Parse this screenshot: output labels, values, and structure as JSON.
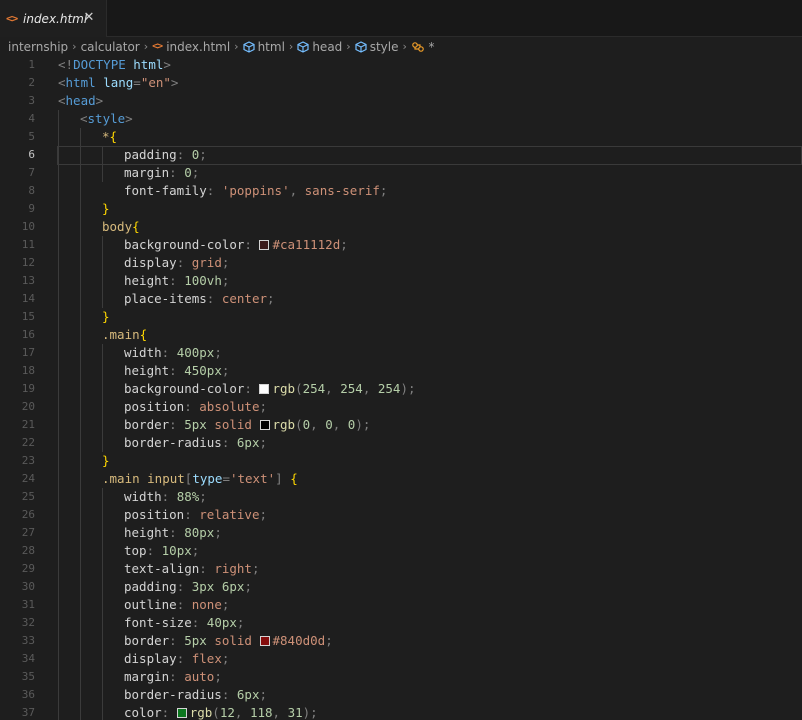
{
  "tab": {
    "label": "index.html",
    "file_icon": "<>",
    "close_glyph": "✕"
  },
  "breadcrumb": {
    "parts": [
      "internship",
      "calculator",
      "index.html",
      "html",
      "head",
      "style"
    ],
    "last": "*",
    "separator": "›"
  },
  "editor": {
    "current_line": 6,
    "lines": [
      {
        "n": "1",
        "tokens": [
          [
            "punc",
            "<!"
          ],
          [
            "tag",
            "DOCTYPE"
          ],
          [
            "text",
            " "
          ],
          [
            "attr",
            "html"
          ],
          [
            "punc",
            ">"
          ]
        ],
        "indent": 0
      },
      {
        "n": "2",
        "tokens": [
          [
            "punc",
            "<"
          ],
          [
            "tag",
            "html"
          ],
          [
            "text",
            " "
          ],
          [
            "attr",
            "lang"
          ],
          [
            "punc",
            "="
          ],
          [
            "str",
            "\"en\""
          ],
          [
            "punc",
            ">"
          ]
        ],
        "indent": 0
      },
      {
        "n": "3",
        "tokens": [
          [
            "punc",
            "<"
          ],
          [
            "tag",
            "head"
          ],
          [
            "punc",
            ">"
          ]
        ],
        "indent": 0
      },
      {
        "n": "4",
        "tokens": [
          [
            "punc",
            "<"
          ],
          [
            "tag",
            "style"
          ],
          [
            "punc",
            ">"
          ]
        ],
        "indent": 1
      },
      {
        "n": "5",
        "tokens": [
          [
            "sel",
            "*"
          ],
          [
            "brace",
            "{"
          ]
        ],
        "indent": 2
      },
      {
        "n": "6",
        "tokens": [
          [
            "prop",
            "padding"
          ],
          [
            "punc",
            ": "
          ],
          [
            "num",
            "0"
          ],
          [
            "punc",
            ";"
          ]
        ],
        "indent": 3
      },
      {
        "n": "7",
        "tokens": [
          [
            "prop",
            "margin"
          ],
          [
            "punc",
            ": "
          ],
          [
            "num",
            "0"
          ],
          [
            "punc",
            ";"
          ]
        ],
        "indent": 3
      },
      {
        "n": "8",
        "tokens": [
          [
            "prop",
            "font-family"
          ],
          [
            "punc",
            ": "
          ],
          [
            "str",
            "'poppins'"
          ],
          [
            "punc",
            ", "
          ],
          [
            "val",
            "sans-serif"
          ],
          [
            "punc",
            ";"
          ]
        ],
        "indent": 3
      },
      {
        "n": "9",
        "tokens": [
          [
            "brace",
            "}"
          ]
        ],
        "indent": 2
      },
      {
        "n": "10",
        "tokens": [
          [
            "sel",
            "body"
          ],
          [
            "brace",
            "{"
          ]
        ],
        "indent": 2
      },
      {
        "n": "11",
        "tokens": [
          [
            "prop",
            "background-color"
          ],
          [
            "punc",
            ": "
          ],
          [
            "swatch",
            "#ca11112d"
          ],
          [
            "val",
            "#ca11112d"
          ],
          [
            "punc",
            ";"
          ]
        ],
        "indent": 3
      },
      {
        "n": "12",
        "tokens": [
          [
            "prop",
            "display"
          ],
          [
            "punc",
            ": "
          ],
          [
            "val",
            "grid"
          ],
          [
            "punc",
            ";"
          ]
        ],
        "indent": 3
      },
      {
        "n": "13",
        "tokens": [
          [
            "prop",
            "height"
          ],
          [
            "punc",
            ": "
          ],
          [
            "num",
            "100vh"
          ],
          [
            "punc",
            ";"
          ]
        ],
        "indent": 3
      },
      {
        "n": "14",
        "tokens": [
          [
            "prop",
            "place-items"
          ],
          [
            "punc",
            ": "
          ],
          [
            "val",
            "center"
          ],
          [
            "punc",
            ";"
          ]
        ],
        "indent": 3
      },
      {
        "n": "15",
        "tokens": [
          [
            "brace",
            "}"
          ]
        ],
        "indent": 2
      },
      {
        "n": "16",
        "tokens": [
          [
            "sel",
            ".main"
          ],
          [
            "brace",
            "{"
          ]
        ],
        "indent": 2
      },
      {
        "n": "17",
        "tokens": [
          [
            "prop",
            "width"
          ],
          [
            "punc",
            ": "
          ],
          [
            "num",
            "400px"
          ],
          [
            "punc",
            ";"
          ]
        ],
        "indent": 3
      },
      {
        "n": "18",
        "tokens": [
          [
            "prop",
            "height"
          ],
          [
            "punc",
            ": "
          ],
          [
            "num",
            "450px"
          ],
          [
            "punc",
            ";"
          ]
        ],
        "indent": 3
      },
      {
        "n": "19",
        "tokens": [
          [
            "prop",
            "background-color"
          ],
          [
            "punc",
            ": "
          ],
          [
            "swatch",
            "#fefefe"
          ],
          [
            "fn",
            "rgb"
          ],
          [
            "punc",
            "("
          ],
          [
            "num",
            "254"
          ],
          [
            "punc",
            ", "
          ],
          [
            "num",
            "254"
          ],
          [
            "punc",
            ", "
          ],
          [
            "num",
            "254"
          ],
          [
            "punc",
            ");"
          ]
        ],
        "indent": 3
      },
      {
        "n": "20",
        "tokens": [
          [
            "prop",
            "position"
          ],
          [
            "punc",
            ": "
          ],
          [
            "val",
            "absolute"
          ],
          [
            "punc",
            ";"
          ]
        ],
        "indent": 3
      },
      {
        "n": "21",
        "tokens": [
          [
            "prop",
            "border"
          ],
          [
            "punc",
            ": "
          ],
          [
            "num",
            "5px"
          ],
          [
            "text",
            " "
          ],
          [
            "val",
            "solid"
          ],
          [
            "text",
            " "
          ],
          [
            "swatch",
            "#000000"
          ],
          [
            "fn",
            "rgb"
          ],
          [
            "punc",
            "("
          ],
          [
            "num",
            "0"
          ],
          [
            "punc",
            ", "
          ],
          [
            "num",
            "0"
          ],
          [
            "punc",
            ", "
          ],
          [
            "num",
            "0"
          ],
          [
            "punc",
            ");"
          ]
        ],
        "indent": 3
      },
      {
        "n": "22",
        "tokens": [
          [
            "prop",
            "border-radius"
          ],
          [
            "punc",
            ": "
          ],
          [
            "num",
            "6px"
          ],
          [
            "punc",
            ";"
          ]
        ],
        "indent": 3
      },
      {
        "n": "23",
        "tokens": [
          [
            "brace",
            "}"
          ]
        ],
        "indent": 2
      },
      {
        "n": "24",
        "tokens": [
          [
            "sel",
            ".main input"
          ],
          [
            "punc",
            "["
          ],
          [
            "attr",
            "type"
          ],
          [
            "punc",
            "="
          ],
          [
            "str",
            "'text'"
          ],
          [
            "punc",
            "]"
          ],
          [
            "text",
            " "
          ],
          [
            "brace",
            "{"
          ]
        ],
        "indent": 2
      },
      {
        "n": "25",
        "tokens": [
          [
            "prop",
            "width"
          ],
          [
            "punc",
            ": "
          ],
          [
            "num",
            "88%"
          ],
          [
            "punc",
            ";"
          ]
        ],
        "indent": 3
      },
      {
        "n": "26",
        "tokens": [
          [
            "prop",
            "position"
          ],
          [
            "punc",
            ": "
          ],
          [
            "val",
            "relative"
          ],
          [
            "punc",
            ";"
          ]
        ],
        "indent": 3
      },
      {
        "n": "27",
        "tokens": [
          [
            "prop",
            "height"
          ],
          [
            "punc",
            ": "
          ],
          [
            "num",
            "80px"
          ],
          [
            "punc",
            ";"
          ]
        ],
        "indent": 3
      },
      {
        "n": "28",
        "tokens": [
          [
            "prop",
            "top"
          ],
          [
            "punc",
            ": "
          ],
          [
            "num",
            "10px"
          ],
          [
            "punc",
            ";"
          ]
        ],
        "indent": 3
      },
      {
        "n": "29",
        "tokens": [
          [
            "prop",
            "text-align"
          ],
          [
            "punc",
            ": "
          ],
          [
            "val",
            "right"
          ],
          [
            "punc",
            ";"
          ]
        ],
        "indent": 3
      },
      {
        "n": "30",
        "tokens": [
          [
            "prop",
            "padding"
          ],
          [
            "punc",
            ": "
          ],
          [
            "num",
            "3px"
          ],
          [
            "text",
            " "
          ],
          [
            "num",
            "6px"
          ],
          [
            "punc",
            ";"
          ]
        ],
        "indent": 3
      },
      {
        "n": "31",
        "tokens": [
          [
            "prop",
            "outline"
          ],
          [
            "punc",
            ": "
          ],
          [
            "val",
            "none"
          ],
          [
            "punc",
            ";"
          ]
        ],
        "indent": 3
      },
      {
        "n": "32",
        "tokens": [
          [
            "prop",
            "font-size"
          ],
          [
            "punc",
            ": "
          ],
          [
            "num",
            "40px"
          ],
          [
            "punc",
            ";"
          ]
        ],
        "indent": 3
      },
      {
        "n": "33",
        "tokens": [
          [
            "prop",
            "border"
          ],
          [
            "punc",
            ": "
          ],
          [
            "num",
            "5px"
          ],
          [
            "text",
            " "
          ],
          [
            "val",
            "solid"
          ],
          [
            "text",
            " "
          ],
          [
            "swatch",
            "#840d0d"
          ],
          [
            "val",
            "#840d0d"
          ],
          [
            "punc",
            ";"
          ]
        ],
        "indent": 3
      },
      {
        "n": "34",
        "tokens": [
          [
            "prop",
            "display"
          ],
          [
            "punc",
            ": "
          ],
          [
            "val",
            "flex"
          ],
          [
            "punc",
            ";"
          ]
        ],
        "indent": 3
      },
      {
        "n": "35",
        "tokens": [
          [
            "prop",
            "margin"
          ],
          [
            "punc",
            ": "
          ],
          [
            "val",
            "auto"
          ],
          [
            "punc",
            ";"
          ]
        ],
        "indent": 3
      },
      {
        "n": "36",
        "tokens": [
          [
            "prop",
            "border-radius"
          ],
          [
            "punc",
            ": "
          ],
          [
            "num",
            "6px"
          ],
          [
            "punc",
            ";"
          ]
        ],
        "indent": 3
      },
      {
        "n": "37",
        "tokens": [
          [
            "prop",
            "color"
          ],
          [
            "punc",
            ": "
          ],
          [
            "swatch",
            "#0c761f"
          ],
          [
            "fn",
            "rgb"
          ],
          [
            "punc",
            "("
          ],
          [
            "num",
            "12"
          ],
          [
            "punc",
            ", "
          ],
          [
            "num",
            "118"
          ],
          [
            "punc",
            ", "
          ],
          [
            "num",
            "31"
          ],
          [
            "punc",
            ");"
          ]
        ],
        "indent": 3
      }
    ]
  }
}
